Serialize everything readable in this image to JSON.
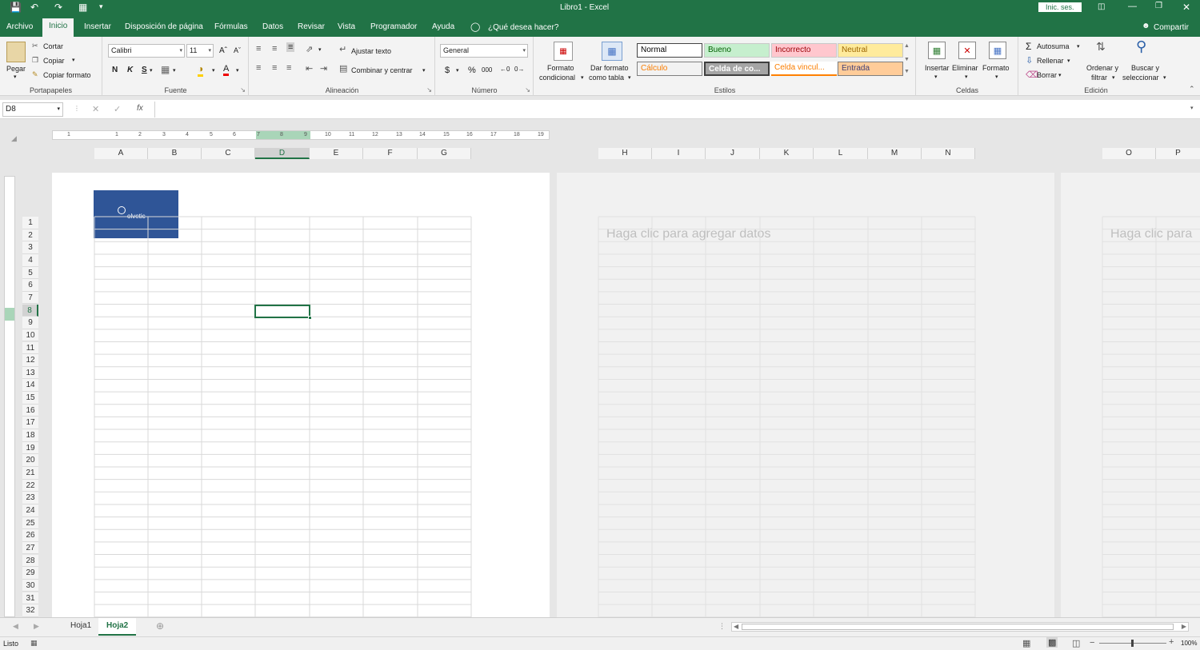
{
  "app": {
    "title": "Libro1  -  Excel",
    "signin_label": "Inic. ses.",
    "share_label": "Compartir",
    "tell_me": "¿Qué desea hacer?"
  },
  "tabs": [
    "Archivo",
    "Inicio",
    "Insertar",
    "Disposición de página",
    "Fórmulas",
    "Datos",
    "Revisar",
    "Vista",
    "Programador",
    "Ayuda"
  ],
  "ribbon": {
    "clipboard": {
      "label": "Portapapeles",
      "paste": "Pegar",
      "cut": "Cortar",
      "copy": "Copiar",
      "format_painter": "Copiar formato"
    },
    "font": {
      "label": "Fuente",
      "name": "Calibri",
      "size": "11",
      "bold": "N",
      "italic": "K",
      "underline": "S"
    },
    "alignment": {
      "label": "Alineación",
      "wrap": "Ajustar texto",
      "merge": "Combinar y centrar"
    },
    "number": {
      "label": "Número",
      "format": "General"
    },
    "styles": {
      "label": "Estilos",
      "conditional_line1": "Formato",
      "conditional_line2": "condicional",
      "table_line1": "Dar formato",
      "table_line2": "como tabla",
      "normal": "Normal",
      "bueno": "Bueno",
      "incorrecto": "Incorrecto",
      "neutral": "Neutral",
      "calculo": "Cálculo",
      "celda_comprobacion": "Celda de co...",
      "celda_vinculada": "Celda vincul...",
      "entrada": "Entrada"
    },
    "cells": {
      "label": "Celdas",
      "insert": "Insertar",
      "delete": "Eliminar",
      "format": "Formato"
    },
    "editing": {
      "label": "Edición",
      "autosum": "Autosuma",
      "fill": "Rellenar",
      "clear": "Borrar",
      "sort_line1": "Ordenar y",
      "sort_line2": "filtrar",
      "find_line1": "Buscar y",
      "find_line2": "seleccionar"
    }
  },
  "formula_bar": {
    "name_box": "D8",
    "fx": "fx",
    "formula": ""
  },
  "ruler": [
    "1",
    "1",
    "2",
    "3",
    "4",
    "5",
    "6",
    "7",
    "8",
    "9",
    "10",
    "11",
    "12",
    "13",
    "14",
    "15",
    "16",
    "17",
    "18",
    "19"
  ],
  "columns_page1": [
    "A",
    "B",
    "C",
    "D",
    "E",
    "F",
    "G"
  ],
  "columns_page2": [
    "H",
    "I",
    "J",
    "K",
    "L",
    "M",
    "N"
  ],
  "columns_page3": [
    "O",
    "P"
  ],
  "rows": [
    "1",
    "2",
    "3",
    "4",
    "5",
    "6",
    "7",
    "8",
    "9",
    "10",
    "11",
    "12",
    "13",
    "14",
    "15",
    "16",
    "17",
    "18",
    "19",
    "20",
    "21",
    "22",
    "23",
    "24",
    "25",
    "26",
    "27",
    "28",
    "29",
    "30",
    "31",
    "32"
  ],
  "header_image_text": "olvetic",
  "placeholder": "Haga clic para agregar datos",
  "placeholder_short": "Haga clic para",
  "selected_cell": "D8",
  "sheets": [
    "Hoja1",
    "Hoja2"
  ],
  "active_sheet": "Hoja2",
  "status": {
    "ready": "Listo",
    "zoom": "100%"
  },
  "colors": {
    "excel_green": "#217346",
    "header_fill": "#2f5597",
    "selection": "#217346"
  }
}
